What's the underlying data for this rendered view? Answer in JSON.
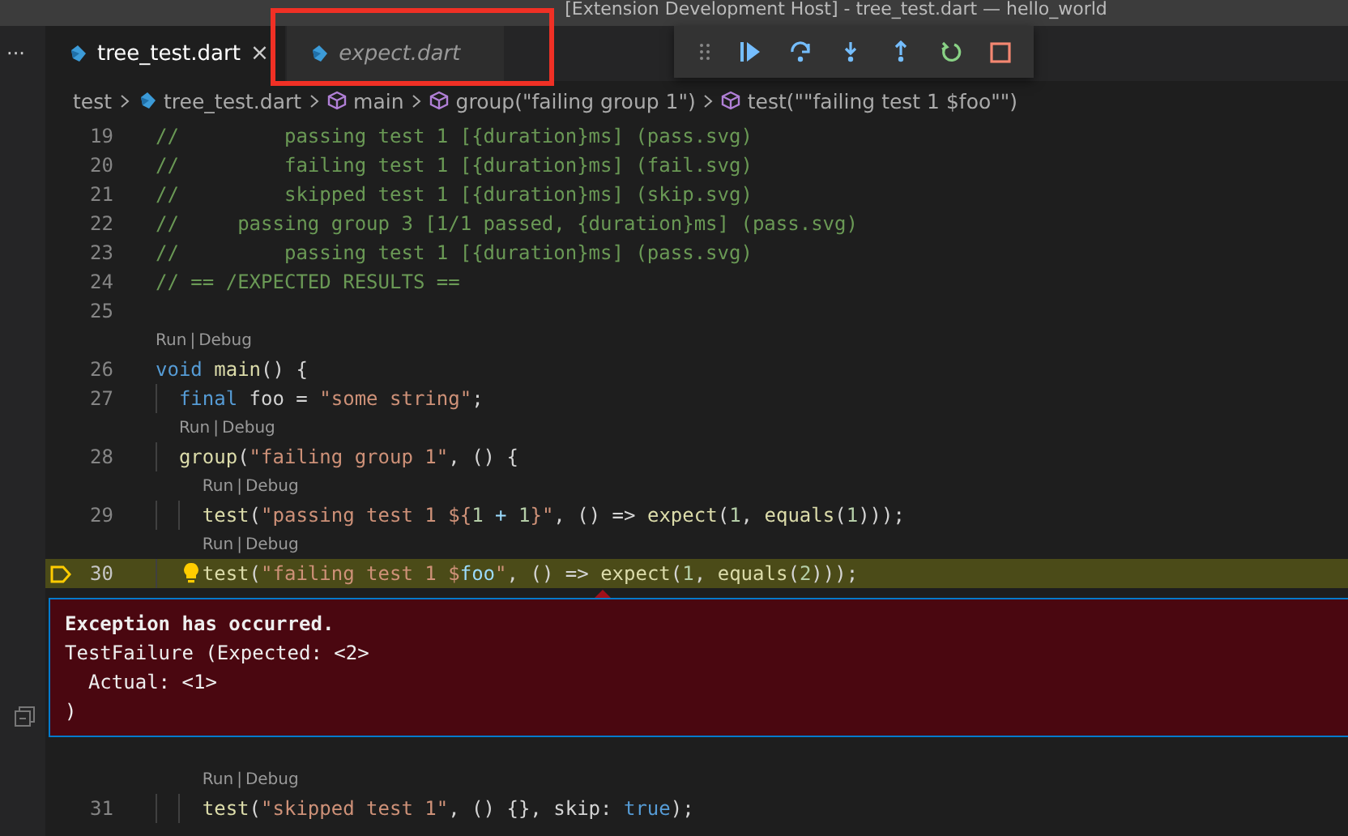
{
  "window": {
    "title": "[Extension Development Host] - tree_test.dart — hello_world"
  },
  "sidebar": {
    "more": "···"
  },
  "tabs": [
    {
      "label": "tree_test.dart",
      "selected": true,
      "preview": false,
      "close": "×",
      "annotated": false
    },
    {
      "label": "expect.dart",
      "selected": false,
      "preview": true,
      "annotated": true
    }
  ],
  "breadcrumbs": [
    {
      "kind": "folder",
      "label": "test"
    },
    {
      "kind": "file",
      "label": "tree_test.dart"
    },
    {
      "kind": "symbol",
      "label": "main"
    },
    {
      "kind": "symbol",
      "label": "group(\"failing group 1\")"
    },
    {
      "kind": "symbol",
      "label": "test(\"\"failing test 1 $foo\"\")"
    }
  ],
  "editor": {
    "lines": [
      {
        "kind": "code",
        "number": "19",
        "current": false,
        "paused": false,
        "lightbulb": false,
        "tokens": [
          {
            "kind": "comment",
            "text": "//         passing test 1 [{duration}ms] (pass.svg)"
          }
        ]
      },
      {
        "kind": "code",
        "number": "20",
        "current": false,
        "paused": false,
        "lightbulb": false,
        "tokens": [
          {
            "kind": "comment",
            "text": "//         failing test 1 [{duration}ms] (fail.svg)"
          }
        ]
      },
      {
        "kind": "code",
        "number": "21",
        "current": false,
        "paused": false,
        "lightbulb": false,
        "tokens": [
          {
            "kind": "comment",
            "text": "//         skipped test 1 [{duration}ms] (skip.svg)"
          }
        ]
      },
      {
        "kind": "code",
        "number": "22",
        "current": false,
        "paused": false,
        "lightbulb": false,
        "tokens": [
          {
            "kind": "comment",
            "text": "//     passing group 3 [1/1 passed, {duration}ms] (pass.svg)"
          }
        ]
      },
      {
        "kind": "code",
        "number": "23",
        "current": false,
        "paused": false,
        "lightbulb": false,
        "tokens": [
          {
            "kind": "comment",
            "text": "//         passing test 1 [{duration}ms] (pass.svg)"
          }
        ]
      },
      {
        "kind": "code",
        "number": "24",
        "current": false,
        "paused": false,
        "lightbulb": false,
        "tokens": [
          {
            "kind": "comment",
            "text": "// == /EXPECTED RESULTS =="
          }
        ]
      },
      {
        "kind": "code",
        "number": "25",
        "current": false,
        "paused": false,
        "lightbulb": false
      },
      {
        "kind": "codelens",
        "links": [
          "Run",
          "Debug"
        ],
        "separator": "|"
      },
      {
        "kind": "code",
        "number": "26",
        "current": false,
        "paused": false,
        "lightbulb": false,
        "tokens": [
          {
            "kind": "keyword",
            "text": "void"
          },
          {
            "kind": "function",
            "text": " main"
          },
          {
            "kind": "plain",
            "text": "() {"
          }
        ]
      },
      {
        "kind": "code",
        "number": "27",
        "current": false,
        "paused": false,
        "lightbulb": false,
        "tokens": [
          {
            "kind": "keyword",
            "text": "  final"
          },
          {
            "kind": "plain",
            "text": " foo = "
          },
          {
            "kind": "string",
            "text": "\"some string\""
          },
          {
            "kind": "plain",
            "text": ";"
          }
        ]
      },
      {
        "kind": "codelens",
        "links": [
          "Run",
          "Debug"
        ],
        "separator": "|"
      },
      {
        "kind": "code",
        "number": "28",
        "current": false,
        "paused": false,
        "lightbulb": false,
        "tokens": [
          {
            "kind": "function",
            "text": "  group"
          },
          {
            "kind": "plain",
            "text": "("
          },
          {
            "kind": "string",
            "text": "\"failing group 1\""
          },
          {
            "kind": "plain",
            "text": ", () {"
          }
        ]
      },
      {
        "kind": "codelens",
        "links": [
          "Run",
          "Debug"
        ],
        "separator": "|"
      },
      {
        "kind": "code",
        "number": "29",
        "current": false,
        "paused": false,
        "lightbulb": false,
        "tokens": [
          {
            "kind": "function",
            "text": "    test"
          },
          {
            "kind": "plain",
            "text": "("
          },
          {
            "kind": "string",
            "text": "\"passing test 1 ${"
          },
          {
            "kind": "number",
            "text": "1"
          },
          {
            "kind": "variable",
            "text": " + "
          },
          {
            "kind": "number",
            "text": "1"
          },
          {
            "kind": "string",
            "text": "}\""
          },
          {
            "kind": "plain",
            "text": ", () => "
          },
          {
            "kind": "function",
            "text": "expect"
          },
          {
            "kind": "plain",
            "text": "("
          },
          {
            "kind": "number",
            "text": "1"
          },
          {
            "kind": "plain",
            "text": ", "
          },
          {
            "kind": "function",
            "text": "equals"
          },
          {
            "kind": "plain",
            "text": "("
          },
          {
            "kind": "number",
            "text": "1"
          },
          {
            "kind": "plain",
            "text": ")));"
          }
        ]
      },
      {
        "kind": "codelens",
        "links": [
          "Run",
          "Debug"
        ],
        "separator": "|"
      },
      {
        "kind": "code",
        "number": "30",
        "current": true,
        "paused": true,
        "lightbulb": true,
        "tokens": [
          {
            "kind": "function",
            "text": "    test"
          },
          {
            "kind": "plain",
            "text": "("
          },
          {
            "kind": "string",
            "text": "\"failing test 1 $"
          },
          {
            "kind": "variable",
            "text": "foo"
          },
          {
            "kind": "string",
            "text": "\""
          },
          {
            "kind": "plain",
            "text": ", () => "
          },
          {
            "kind": "function",
            "text": "expect"
          },
          {
            "kind": "plain",
            "text": "("
          },
          {
            "kind": "number",
            "text": "1"
          },
          {
            "kind": "plain",
            "text": ", "
          },
          {
            "kind": "function",
            "text": "equals"
          },
          {
            "kind": "plain",
            "text": "("
          },
          {
            "kind": "number",
            "text": "2"
          },
          {
            "kind": "plain",
            "text": ")));"
          }
        ]
      },
      {
        "kind": "exception",
        "title": "Exception has occurred.",
        "lines": [
          "TestFailure (Expected: <2>",
          "  Actual: <1>",
          ")"
        ]
      },
      {
        "kind": "codelens",
        "links": [
          "Run",
          "Debug"
        ],
        "separator": "|"
      },
      {
        "kind": "code",
        "number": "31",
        "current": false,
        "paused": false,
        "lightbulb": false,
        "tokens": [
          {
            "kind": "function",
            "text": "    test"
          },
          {
            "kind": "plain",
            "text": "("
          },
          {
            "kind": "string",
            "text": "\"skipped test 1\""
          },
          {
            "kind": "plain",
            "text": ", () {}, skip: "
          },
          {
            "kind": "keyword",
            "text": "true"
          },
          {
            "kind": "plain",
            "text": ");"
          }
        ]
      }
    ]
  }
}
